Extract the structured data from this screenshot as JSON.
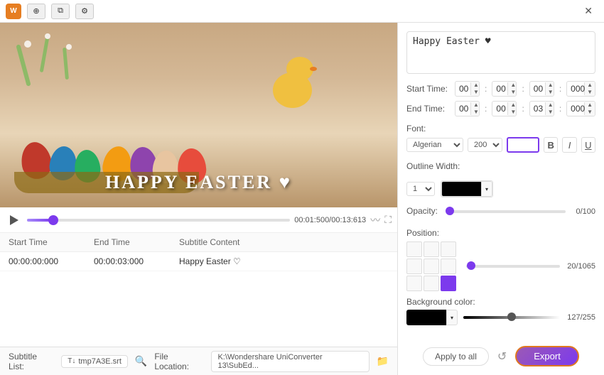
{
  "titlebar": {
    "close_label": "✕"
  },
  "toolbar": {
    "add_icon": "⊕",
    "clip_icon": "⧉",
    "settings_icon": "⚙"
  },
  "video": {
    "time_display": "00:01:500/00:13:613",
    "overlay_text": "HAPPY EASTER ♥"
  },
  "controls": {
    "play_state": "paused"
  },
  "subtitle_table": {
    "col_start": "Start Time",
    "col_end": "End Time",
    "col_content": "Subtitle Content",
    "rows": [
      {
        "start": "00:00:00:000",
        "end": "00:00:03:000",
        "content": "Happy Easter ♡"
      }
    ]
  },
  "bottom_bar": {
    "subtitle_list_label": "Subtitle List:",
    "subtitle_file": "T↓ tmp7A3E.srt",
    "file_location_label": "File Location:",
    "file_path": "K:\\Wondershare UniConverter 13\\SubEd..."
  },
  "right_panel": {
    "subtitle_text": "Happy Easter ♥",
    "start_time": {
      "label": "Start Time:",
      "h": "00",
      "m": "00",
      "s": "00",
      "ms": "000"
    },
    "end_time": {
      "label": "End Time:",
      "h": "00",
      "m": "00",
      "s": "03",
      "ms": "000"
    },
    "font_label": "Font:",
    "font_name": "Algerian",
    "font_size": "200",
    "outline_label": "Outline Width:",
    "outline_width": "1",
    "opacity_label": "Opacity:",
    "opacity_value": "0/100",
    "position_label": "Position:",
    "position_value": "20/1065",
    "bg_color_label": "Background color:",
    "bg_value": "127/255",
    "apply_all_label": "Apply to all",
    "export_label": "Export"
  }
}
